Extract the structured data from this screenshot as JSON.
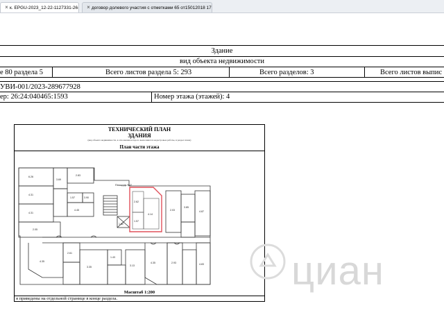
{
  "tabs": [
    {
      "label": "к. EPGU-2023_12-22-1127331-26-01[0] ЭП",
      "active": true
    },
    {
      "label": "договор долевого участия с отметками 65 от15012018 17п",
      "active": false
    }
  ],
  "doc": {
    "header_title": "Здание",
    "header_subtitle": "вид объекта недвижимости",
    "row1": {
      "sheet": "е 80 раздела 5",
      "total_sheets_section": "Всего листов раздела 5: 293",
      "total_sections": "Всего разделов: 3",
      "total_sheets_extract": "Всего листов выпис"
    },
    "record_number": "УВИ-001/2023-289677928",
    "cadastral_number": "ер: 26:24:040465:1593",
    "floor_number": "Номер этажа (этажей): 4"
  },
  "plan": {
    "title1": "ТЕХНИЧЕСКИЙ ПЛАН",
    "title2": "ЗДАНИЯ",
    "subtitle": "(вид объекта недвижимости, в отношении которого выполняются кадастровые работы, и раздел плана)",
    "section_title": "План части этажа",
    "scale": "Масштаб 1:200",
    "note": "я приведены на отдельной странице в конце раздела.",
    "stair_label": "Площадь №2",
    "colors": {
      "highlight": "#e0505a",
      "lines": "#333333"
    }
  },
  "watermark": {
    "text": "циан"
  }
}
